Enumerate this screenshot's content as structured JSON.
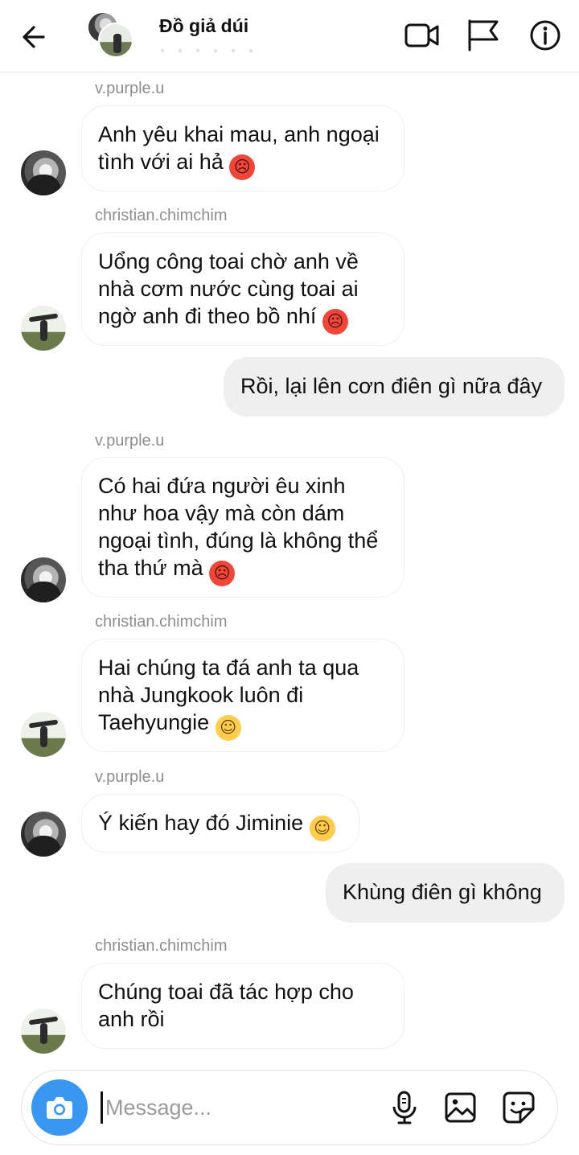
{
  "header": {
    "title": "Đồ giả dúi",
    "icons": [
      "back-arrow-icon",
      "video-call-icon",
      "flag-icon",
      "info-icon"
    ]
  },
  "messages": [
    {
      "sender": "v.purple.u",
      "text": "Anh yêu khai mau, anh ngoại tình với ai hả",
      "emoji": "😡",
      "side": "left"
    },
    {
      "sender": "christian.chimchim",
      "text": "Uổng công toai chờ anh về nhà cơm nước cùng toai ai ngờ anh đi theo bồ nhí",
      "emoji": "😡",
      "side": "left"
    },
    {
      "sender": "",
      "text": "Rồi, lại lên cơn điên gì nữa đây",
      "side": "right"
    },
    {
      "sender": "v.purple.u",
      "text": "Có hai đứa người êu xinh như hoa vậy mà còn dám ngoại tình, đúng là không thể tha thứ mà",
      "emoji": "😡",
      "side": "left"
    },
    {
      "sender": "christian.chimchim",
      "text": "Hai chúng ta đá anh ta qua nhà Jungkook luôn đi Taehyungie",
      "emoji": "😌",
      "side": "left"
    },
    {
      "sender": "v.purple.u",
      "text": "Ý kiến hay đó Jiminie",
      "emoji": "😌",
      "side": "left"
    },
    {
      "sender": "",
      "text": "Khùng điên gì không",
      "side": "right"
    },
    {
      "sender": "christian.chimchim",
      "text": "Chúng toai đã tác hợp cho anh rồi",
      "side": "left"
    }
  ],
  "composer": {
    "placeholder": "Message...",
    "icons": [
      "camera-icon",
      "microphone-icon",
      "gallery-icon",
      "sticker-icon"
    ]
  },
  "colors": {
    "accent": "#3897f0",
    "bubble_mine": "#efefef",
    "sender_text": "#8e8e8e"
  }
}
